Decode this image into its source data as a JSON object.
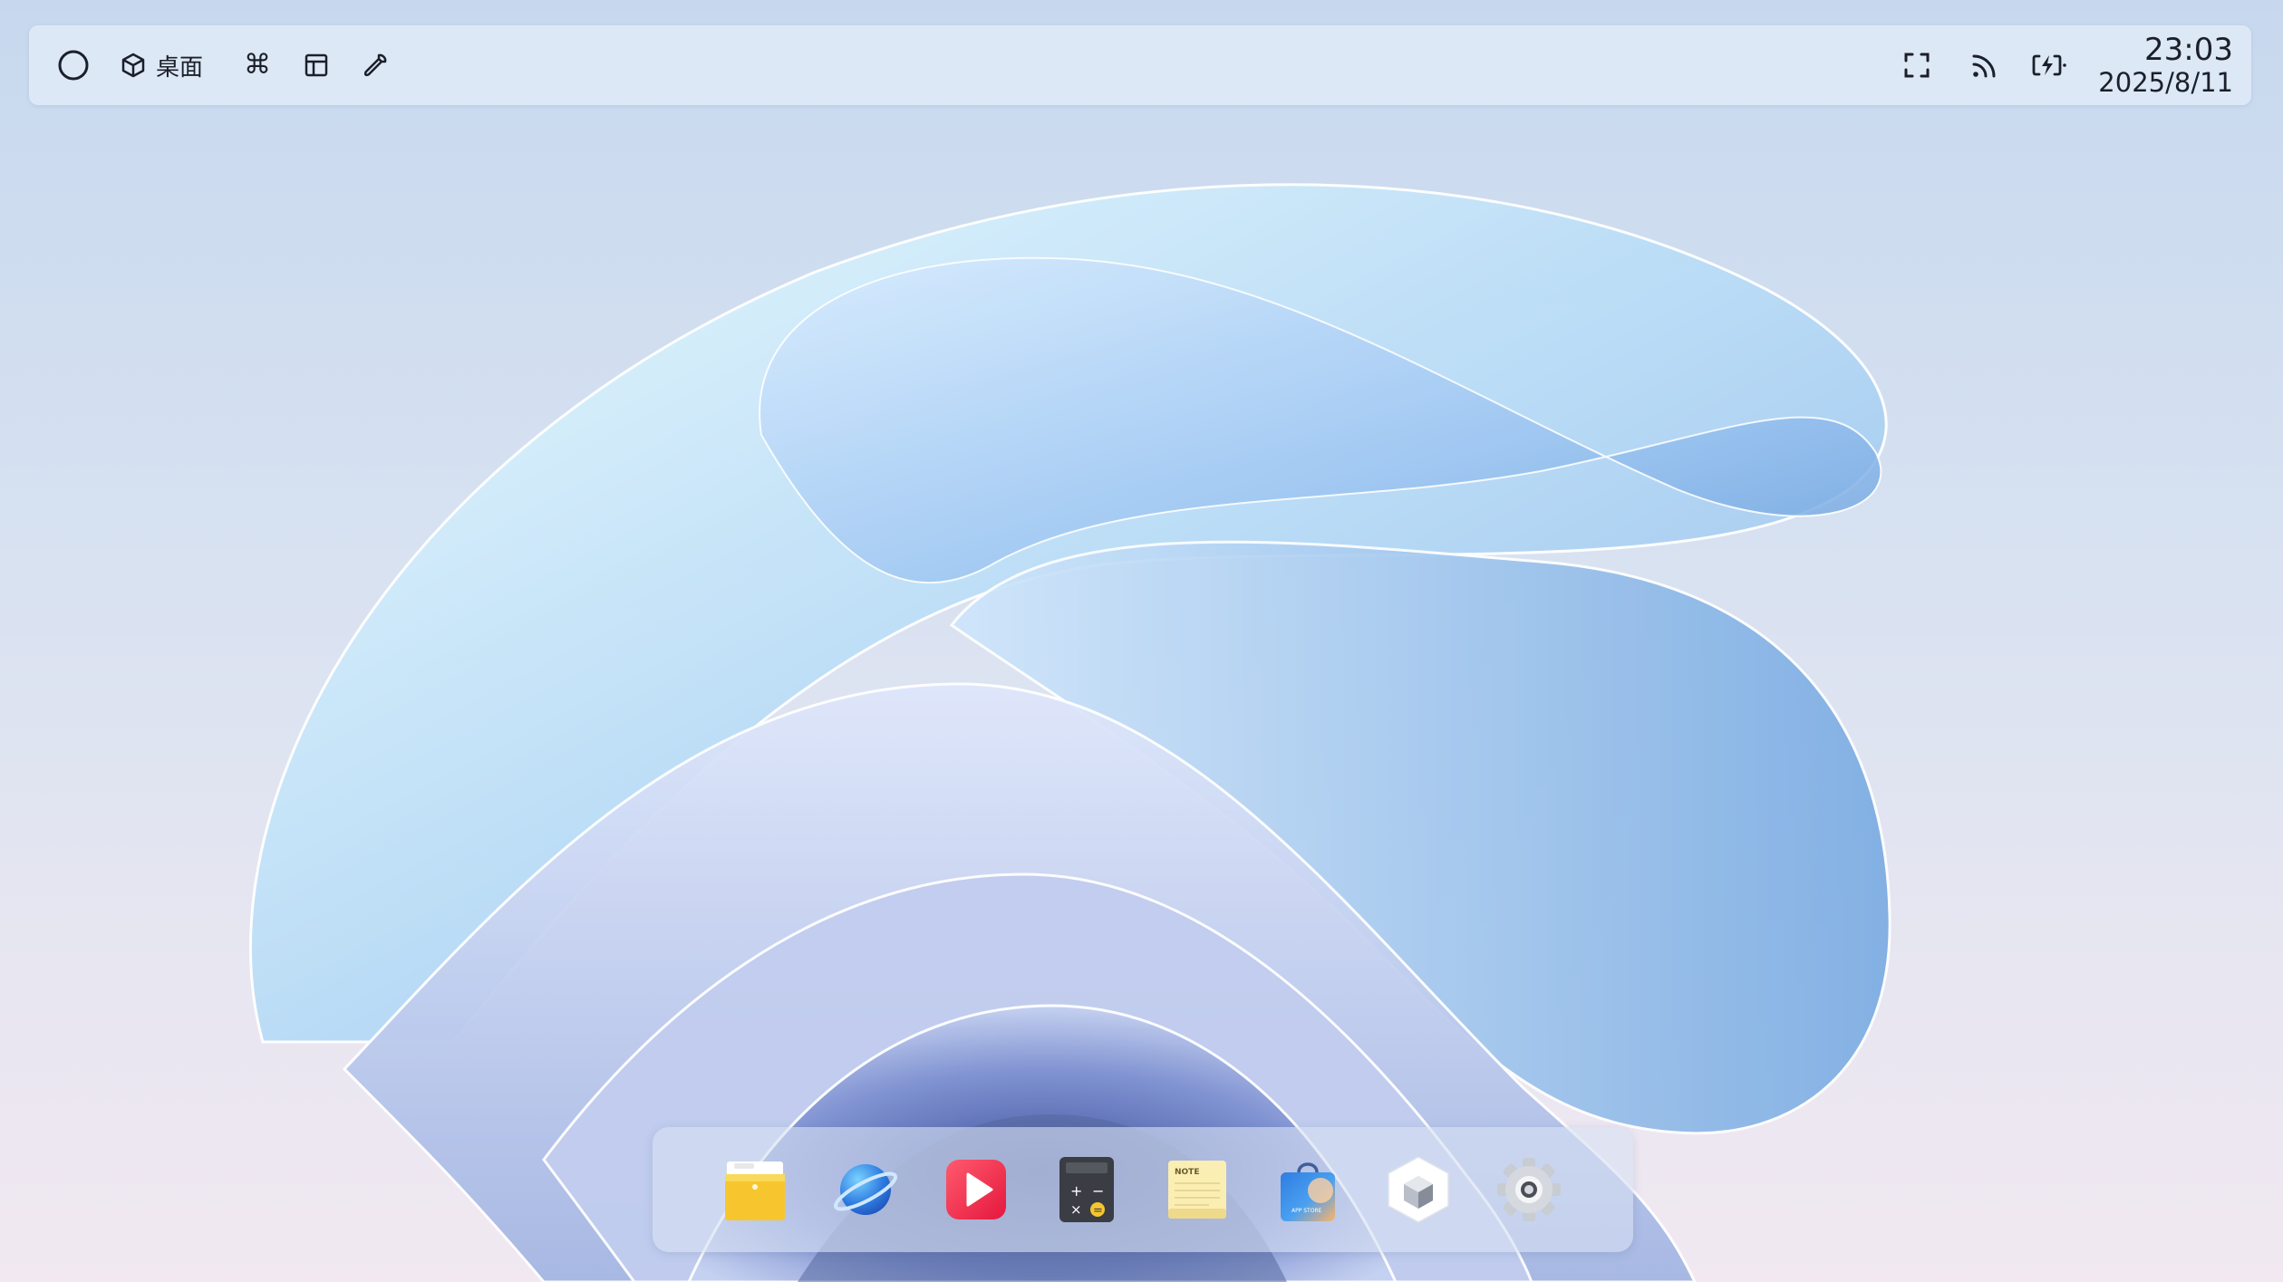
{
  "topbar": {
    "desktop_label": "桌面",
    "time": "23:03",
    "date": "2025/8/11"
  },
  "dock": {
    "apps": [
      "files-app",
      "browser-app",
      "video-player-app",
      "calculator-app",
      "notes-app",
      "app-store-app",
      "package-app",
      "settings-app"
    ],
    "note_label": "NOTE",
    "store_label": "APP STORE"
  },
  "colors": {
    "accent_blue": "#2f7de1",
    "folder_yellow": "#f7c62e",
    "player_red": "#f2304f"
  }
}
